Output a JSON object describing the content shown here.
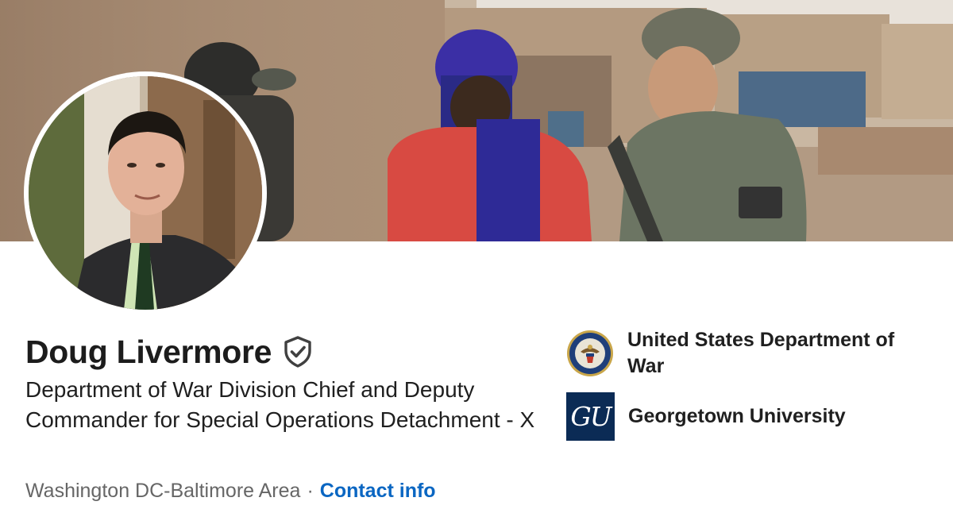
{
  "profile": {
    "name": "Doug Livermore",
    "verified_icon": "verified-shield-check-icon",
    "headline": "Department of War Division Chief and Deputy Commander for Special Operations Detachment - X",
    "location": "Washington DC-Baltimore Area",
    "separator": "·",
    "contact_label": "Contact info"
  },
  "organizations": [
    {
      "name": "United States Department of War",
      "logo": "department-seal-icon"
    },
    {
      "name": "Georgetown University",
      "logo": "georgetown-logo",
      "logo_text": "GU"
    }
  ],
  "colors": {
    "link": "#0a66c2",
    "text_primary": "#1c1c1c",
    "text_secondary": "#666666",
    "gu_navy": "#0b2b55"
  }
}
